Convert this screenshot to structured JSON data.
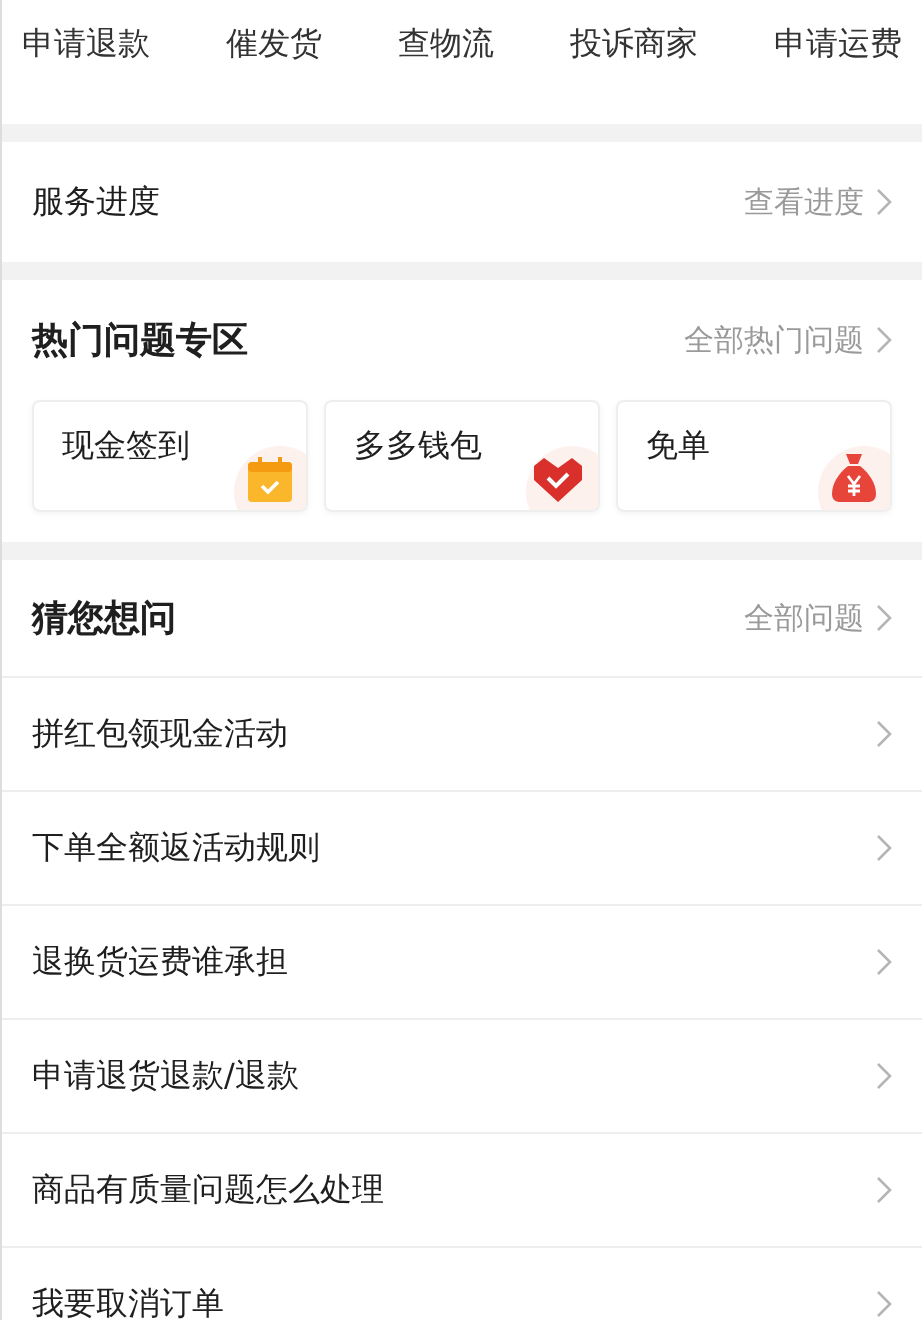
{
  "actions": [
    "申请退款",
    "催发货",
    "查物流",
    "投诉商家",
    "申请运费"
  ],
  "service": {
    "title": "服务进度",
    "link": "查看进度"
  },
  "hot": {
    "title": "热门问题专区",
    "link": "全部热门问题",
    "cards": [
      {
        "label": "现金签到",
        "kind": "calendar"
      },
      {
        "label": "多多钱包",
        "kind": "wallet"
      },
      {
        "label": "免单",
        "kind": "bag"
      }
    ]
  },
  "guess": {
    "title": "猜您想问",
    "link": "全部问题",
    "questions": [
      "拼红包领现金活动",
      "下单全额返活动规则",
      "退换货运费谁承担",
      "申请退货退款/退款",
      "商品有质量问题怎么处理",
      "我要取消订单"
    ]
  }
}
